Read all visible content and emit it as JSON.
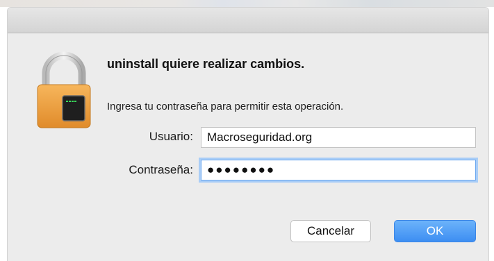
{
  "dialog": {
    "heading": "uninstall quiere realizar cambios.",
    "message": "Ingresa tu contraseña para permitir esta operación.",
    "icon": "lock-icon"
  },
  "form": {
    "username_label": "Usuario:",
    "username_value": "Macroseguridad.org",
    "password_label": "Contraseña:",
    "password_value": "●●●●●●●●"
  },
  "buttons": {
    "cancel_label": "Cancelar",
    "ok_label": "OK"
  },
  "colors": {
    "dialog_background": "#ececec",
    "ok_button": "#4a96f4",
    "focus_ring": "#a9cdf7",
    "lock_body": "#f0a13e"
  }
}
